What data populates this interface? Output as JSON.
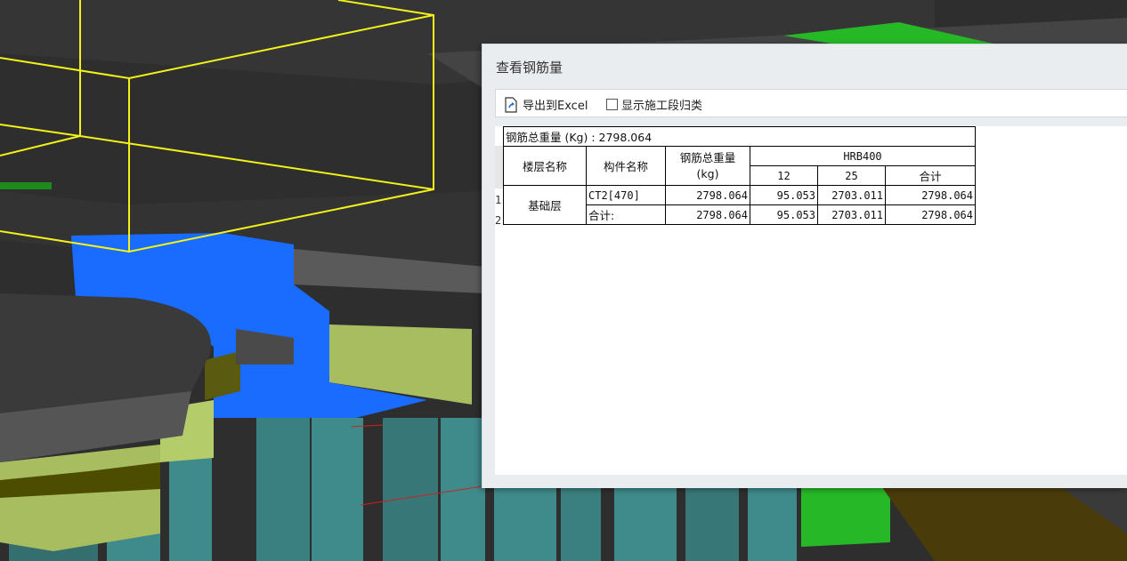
{
  "dialog": {
    "title": "查看钢筋量",
    "toolbar": {
      "export_label": "导出到Excel",
      "show_stage_label": "显示施工段归类",
      "show_stage_checked": false
    }
  },
  "table": {
    "summary": "钢筋总重量 (Kg) : 2798.064",
    "headers": {
      "floor": "楼层名称",
      "component": "构件名称",
      "total_weight_line1": "钢筋总重量",
      "total_weight_line2": "(kg)",
      "grade": "HRB400",
      "sub": [
        "12",
        "25",
        "合计"
      ]
    },
    "row_numbers": [
      "1",
      "2"
    ],
    "rows": [
      {
        "floor": "基础层",
        "component": "CT2[470]",
        "total": "2798.064",
        "d12": "95.053",
        "d25": "2703.011",
        "sum": "2798.064"
      },
      {
        "floor": "",
        "component": "合计:",
        "total": "2798.064",
        "d12": "95.053",
        "d25": "2703.011",
        "sum": "2798.064"
      }
    ]
  },
  "colors": {
    "scene_bg": "#3a3a3a",
    "bounding_box": "#f2f21a",
    "selected_element": "#1a6bff",
    "piles": "#3f8a8a",
    "caps_light": "#a8bd60",
    "green_element": "#26b826"
  }
}
